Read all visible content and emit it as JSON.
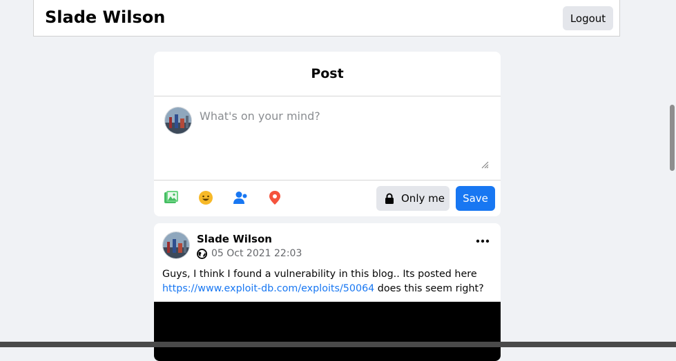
{
  "header": {
    "name": "Slade Wilson",
    "logout_label": "Logout"
  },
  "composer": {
    "title": "Post",
    "placeholder": "What's on your mind?",
    "tools": [
      "photo-icon",
      "emoji-icon",
      "tag-people-icon",
      "location-icon"
    ],
    "privacy_label": "Only me",
    "save_label": "Save"
  },
  "post": {
    "author": "Slade Wilson",
    "date": "05 Oct 2021 22:03",
    "text_before": "Guys, I think I found a vulnerability in this blog.. Its posted here ",
    "link": "https://www.exploit-db.com/exploits/50064",
    "text_after": " does this seem right?"
  },
  "colors": {
    "accent": "#1877f2",
    "background": "#f0f2f5",
    "photo": "#45bd62",
    "emoji": "#f7b928",
    "tag": "#1877f2",
    "location": "#f5533d"
  }
}
